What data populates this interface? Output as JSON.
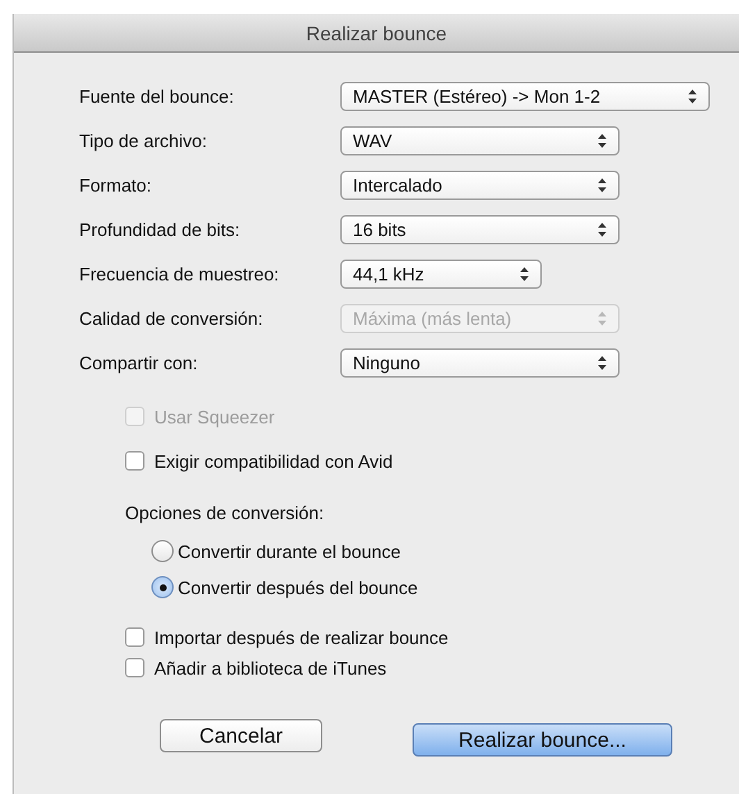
{
  "window": {
    "title": "Realizar bounce"
  },
  "fields": [
    {
      "label": "Fuente del bounce:",
      "value": "MASTER (Estéreo) -> Mon 1-2",
      "disabled": false
    },
    {
      "label": "Tipo de archivo:",
      "value": "WAV",
      "disabled": false
    },
    {
      "label": "Formato:",
      "value": "Intercalado",
      "disabled": false
    },
    {
      "label": "Profundidad de bits:",
      "value": "16 bits",
      "disabled": false
    },
    {
      "label": "Frecuencia de muestreo:",
      "value": "44,1 kHz",
      "disabled": false
    },
    {
      "label": "Calidad de conversión:",
      "value": "Máxima (más lenta)",
      "disabled": true
    },
    {
      "label": "Compartir con:",
      "value": "Ninguno",
      "disabled": false
    }
  ],
  "options": [
    {
      "label": "Usar Squeezer",
      "checked": false,
      "disabled": true
    },
    {
      "label": "Exigir compatibilidad con Avid",
      "checked": false,
      "disabled": false
    }
  ],
  "conversion": {
    "label": "Opciones de conversión:",
    "choices": [
      {
        "label": "Convertir durante el bounce",
        "selected": false
      },
      {
        "label": "Convertir después del bounce",
        "selected": true
      }
    ]
  },
  "after_options": [
    {
      "label": "Importar después de realizar bounce",
      "checked": false
    },
    {
      "label": "Añadir a biblioteca de iTunes",
      "checked": false
    }
  ],
  "buttons": [
    {
      "label": "Cancelar",
      "default": false
    },
    {
      "label": "Realizar bounce...",
      "default": true
    }
  ]
}
